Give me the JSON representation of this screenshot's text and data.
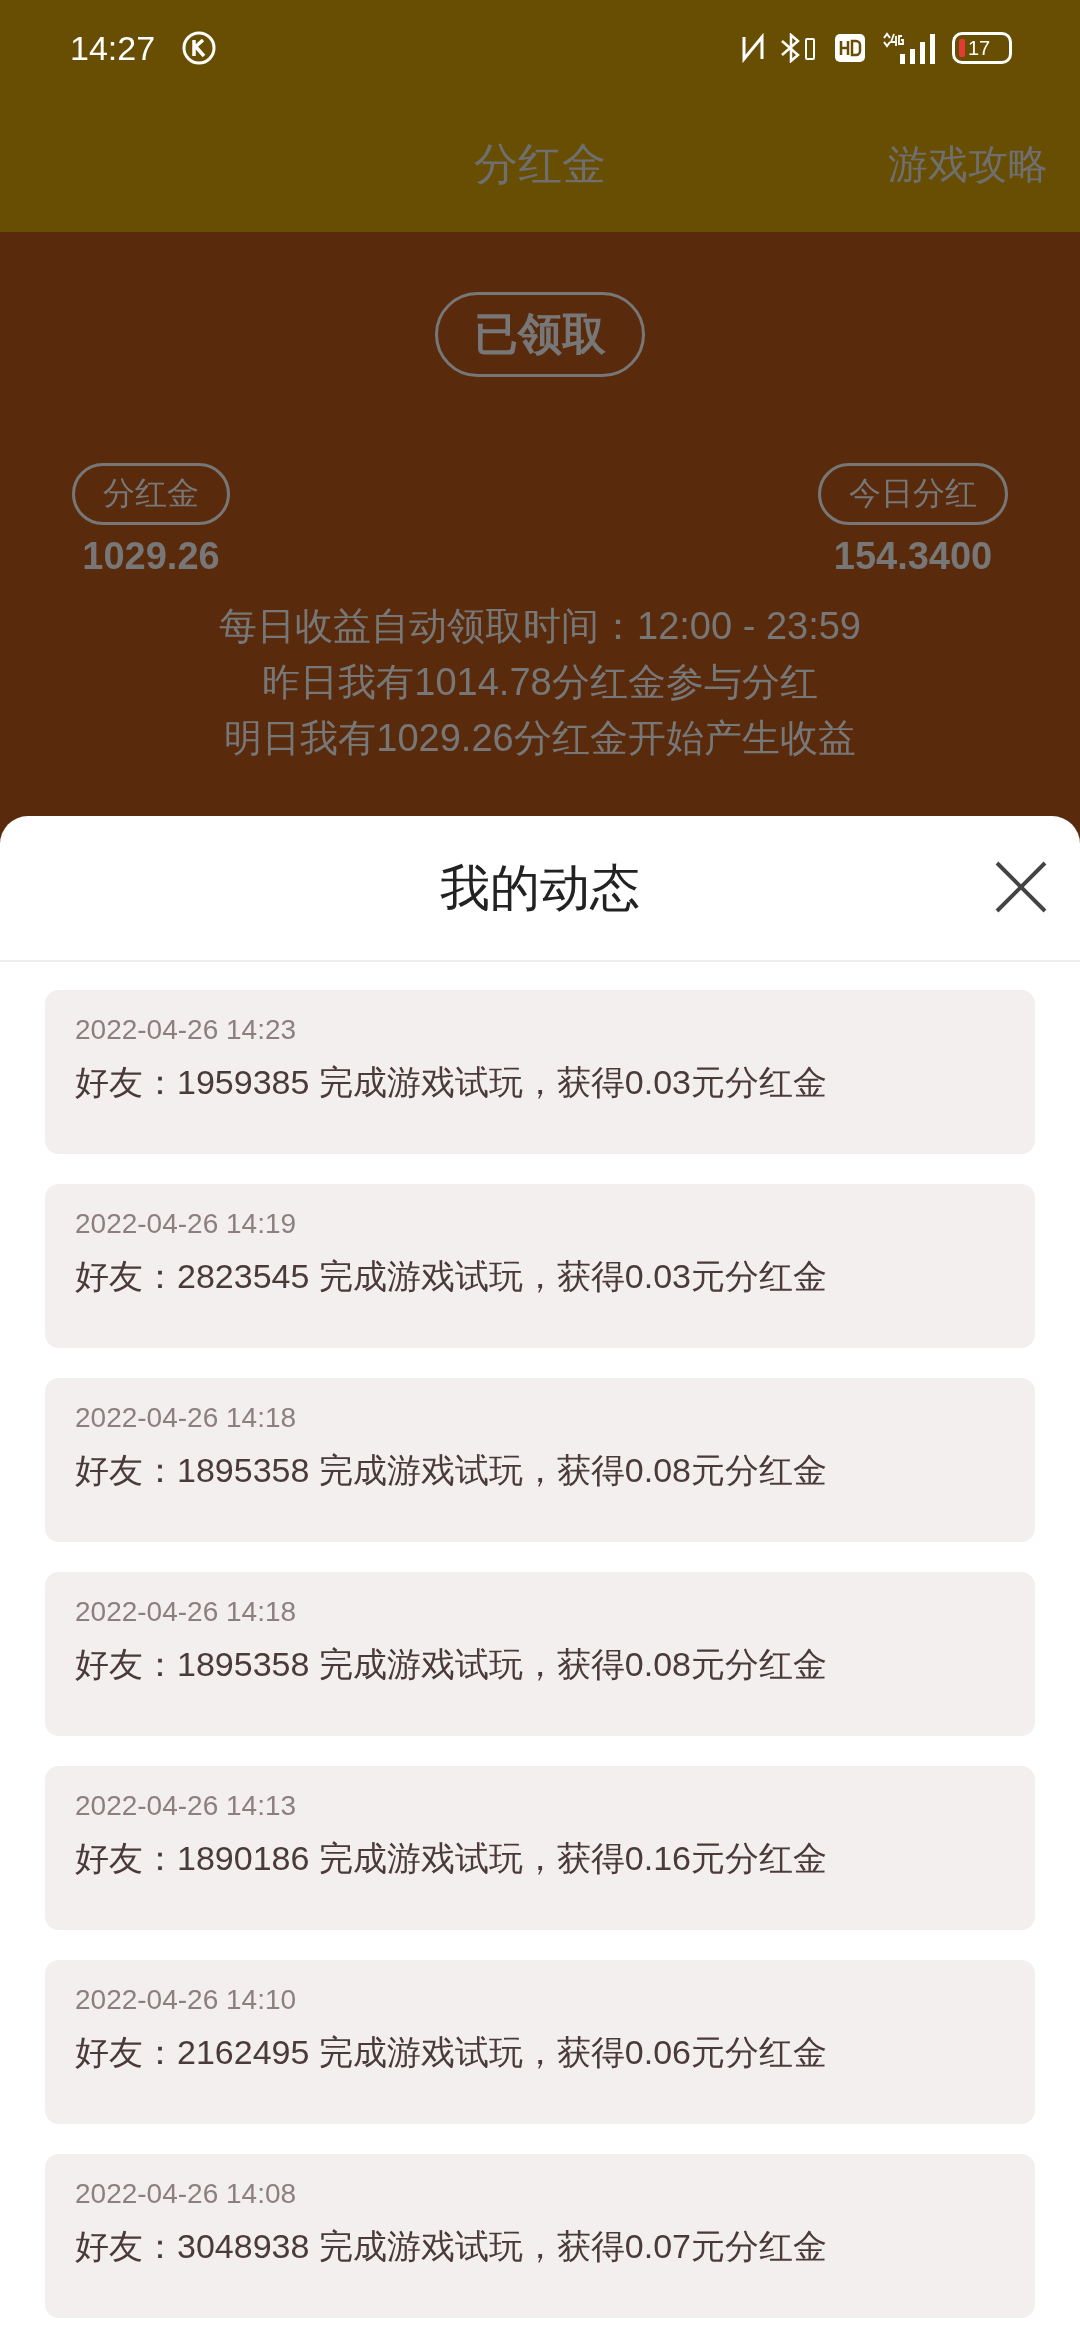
{
  "status_bar": {
    "time": "14:27",
    "battery": "17"
  },
  "header": {
    "title": "分红金",
    "action": "游戏攻略"
  },
  "dividend": {
    "claim_button": "已领取",
    "left": {
      "label": "分红金",
      "value": "1029.26"
    },
    "right": {
      "label": "今日分红",
      "value": "154.3400"
    },
    "notes": [
      "每日收益自动领取时间：12:00 - 23:59",
      "昨日我有1014.78分红金参与分红",
      "明日我有1029.26分红金开始产生收益"
    ]
  },
  "sheet": {
    "title": "我的动态",
    "items": [
      {
        "time": "2022-04-26 14:23",
        "text": "好友：1959385 完成游戏试玩，获得0.03元分红金"
      },
      {
        "time": "2022-04-26 14:19",
        "text": "好友：2823545 完成游戏试玩，获得0.03元分红金"
      },
      {
        "time": "2022-04-26 14:18",
        "text": "好友：1895358 完成游戏试玩，获得0.08元分红金"
      },
      {
        "time": "2022-04-26 14:18",
        "text": "好友：1895358 完成游戏试玩，获得0.08元分红金"
      },
      {
        "time": "2022-04-26 14:13",
        "text": "好友：1890186 完成游戏试玩，获得0.16元分红金"
      },
      {
        "time": "2022-04-26 14:10",
        "text": "好友：2162495 完成游戏试玩，获得0.06元分红金"
      },
      {
        "time": "2022-04-26 14:08",
        "text": "好友：3048938 完成游戏试玩，获得0.07元分红金"
      }
    ]
  }
}
